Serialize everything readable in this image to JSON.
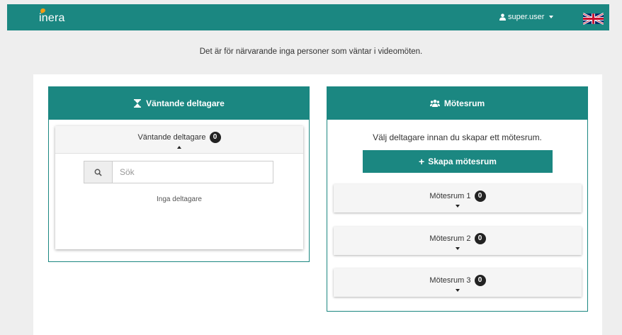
{
  "topbar": {
    "logo_text": "inera",
    "user_name": "super.user"
  },
  "notice": "Det är för närvarande inga personer som väntar i videomöten.",
  "waiting_panel": {
    "title": "Väntande deltagare",
    "section_label": "Väntande deltagare",
    "count": "0",
    "search_placeholder": "Sök",
    "empty_text": "Inga deltagare"
  },
  "rooms_panel": {
    "title": "Mötesrum",
    "hint": "Välj deltagare innan du skapar ett mötesrum.",
    "create_label": "Skapa mötesrum",
    "rooms": [
      {
        "label": "Mötesrum 1",
        "count": "0"
      },
      {
        "label": "Mötesrum 2",
        "count": "0"
      },
      {
        "label": "Mötesrum 3",
        "count": "0"
      }
    ]
  },
  "colors": {
    "brand": "#1b8781",
    "accent": "#f39c12",
    "badge": "#222222"
  },
  "icons": {
    "waiting": "hourglass-icon",
    "rooms": "users-icon",
    "search": "search-icon",
    "user": "user-icon",
    "language": "uk-flag-icon"
  }
}
